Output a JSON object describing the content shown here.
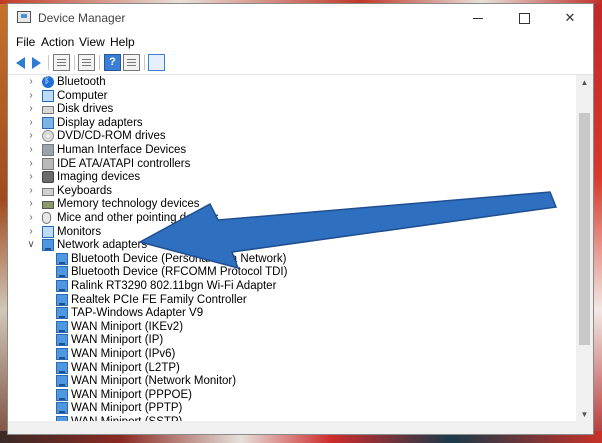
{
  "window": {
    "title": "Device Manager",
    "controls": {
      "minimize": "",
      "maximize": "",
      "close": "✕"
    }
  },
  "menu": [
    "File",
    "Action",
    "View",
    "Help"
  ],
  "toolbar_icons": [
    "back-arrow-icon",
    "forward-arrow-icon",
    "properties-icon",
    "document-icon",
    "help-icon",
    "device-list-icon",
    "monitor-icon"
  ],
  "tree": {
    "categories": [
      {
        "label": "Bluetooth",
        "icon": "bluetooth-icon"
      },
      {
        "label": "Computer",
        "icon": "computer-icon"
      },
      {
        "label": "Disk drives",
        "icon": "disk-drive-icon"
      },
      {
        "label": "Display adapters",
        "icon": "display-adapter-icon"
      },
      {
        "label": "DVD/CD-ROM drives",
        "icon": "dvd-icon"
      },
      {
        "label": "Human Interface Devices",
        "icon": "hid-icon"
      },
      {
        "label": "IDE ATA/ATAPI controllers",
        "icon": "ide-controller-icon"
      },
      {
        "label": "Imaging devices",
        "icon": "camera-icon"
      },
      {
        "label": "Keyboards",
        "icon": "keyboard-icon"
      },
      {
        "label": "Memory technology devices",
        "icon": "memory-icon"
      },
      {
        "label": "Mice and other pointing devices",
        "icon": "mouse-icon"
      },
      {
        "label": "Monitors",
        "icon": "monitor-icon"
      },
      {
        "label": "Network adapters",
        "icon": "network-adapter-icon"
      }
    ],
    "network_children": [
      "Bluetooth Device (Personal Area Network)",
      "Bluetooth Device (RFCOMM Protocol TDI)",
      "Ralink RT3290 802.11bgn Wi-Fi Adapter",
      "Realtek PCIe FE Family Controller",
      "TAP-Windows Adapter V9",
      "WAN Miniport (IKEv2)",
      "WAN Miniport (IP)",
      "WAN Miniport (IPv6)",
      "WAN Miniport (L2TP)",
      "WAN Miniport (Network Monitor)",
      "WAN Miniport (PPPOE)",
      "WAN Miniport (PPTP)",
      "WAN Miniport (SSTP)"
    ]
  },
  "colors": {
    "arrow": "#2f6fbf",
    "accent": "#2f7dd1"
  }
}
